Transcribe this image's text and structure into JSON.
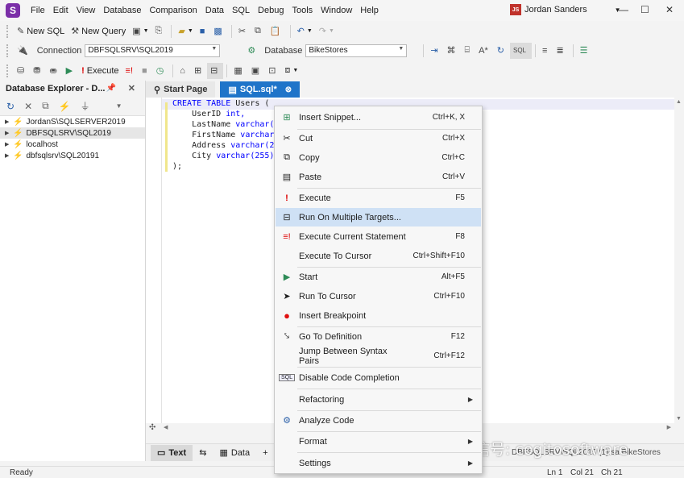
{
  "menubar": {
    "logo": "S",
    "items": [
      "File",
      "Edit",
      "View",
      "Database",
      "Comparison",
      "Data",
      "SQL",
      "Debug",
      "Tools",
      "Window",
      "Help"
    ],
    "user_initials": "JS",
    "user_name": "Jordan Sanders"
  },
  "toolbar1": {
    "new_sql": "New SQL",
    "new_query": "New Query",
    "connection_label": "Connection",
    "connection_value": "DBFSQLSRV\\SQL2019",
    "database_label": "Database",
    "database_value": "BikeStores"
  },
  "toolbar2": {
    "execute": "Execute"
  },
  "explorer": {
    "title": "Database Explorer - D...",
    "items": [
      {
        "label": "JordanS\\SQLSERVER2019"
      },
      {
        "label": "DBFSQLSRV\\SQL2019"
      },
      {
        "label": "localhost"
      },
      {
        "label": "dbfsqlsrv\\SQL20191"
      }
    ]
  },
  "tabs": {
    "start_page": "Start Page",
    "sql": "SQL.sql*"
  },
  "editor": {
    "lines": [
      {
        "kw": "CREATE TABLE",
        "text": " Users ("
      },
      {
        "text": "    UserID ",
        "kw2": "int,"
      },
      {
        "text": "    LastName ",
        "kw2": "varchar("
      },
      {
        "text": "    FirstName ",
        "kw2": "varchar"
      },
      {
        "text": "    Address ",
        "kw2": "varchar(2"
      },
      {
        "text": "    City ",
        "kw2": "varchar(255)"
      },
      {
        "text": ");"
      }
    ]
  },
  "bottom_tabs": {
    "text": "Text",
    "data": "Data"
  },
  "connection_status": "DBFSQLSRV\\SQL2019 (1)   sa   BikeStores",
  "statusbar": {
    "ready": "Ready",
    "ln": "Ln 1",
    "col": "Col 21",
    "ch": "Ch 21"
  },
  "context_menu": [
    {
      "label": "Insert Snippet...",
      "shortcut": "Ctrl+K, X",
      "icon": "snippet-icon"
    },
    {
      "label": "Cut",
      "shortcut": "Ctrl+X",
      "icon": "cut-icon"
    },
    {
      "label": "Copy",
      "shortcut": "Ctrl+C",
      "icon": "copy-icon"
    },
    {
      "label": "Paste",
      "shortcut": "Ctrl+V",
      "icon": "paste-icon"
    },
    {
      "label": "Execute",
      "shortcut": "F5",
      "icon": "execute-icon"
    },
    {
      "label": "Run On Multiple Targets...",
      "shortcut": "",
      "icon": "multiple-targets-icon"
    },
    {
      "label": "Execute Current Statement",
      "shortcut": "F8",
      "icon": "execute-statement-icon"
    },
    {
      "label": "Execute To Cursor",
      "shortcut": "Ctrl+Shift+F10",
      "icon": ""
    },
    {
      "label": "Start",
      "shortcut": "Alt+F5",
      "icon": "start-icon"
    },
    {
      "label": "Run To Cursor",
      "shortcut": "Ctrl+F10",
      "icon": "cursor-icon"
    },
    {
      "label": "Insert Breakpoint",
      "shortcut": "",
      "icon": "breakpoint-icon"
    },
    {
      "label": "Go To Definition",
      "shortcut": "F12",
      "icon": "definition-icon"
    },
    {
      "label": "Jump Between Syntax Pairs",
      "shortcut": "Ctrl+F12",
      "icon": ""
    },
    {
      "label": "Disable Code Completion",
      "shortcut": "",
      "icon": "sql-icon"
    },
    {
      "label": "Refactoring",
      "shortcut": "",
      "icon": ""
    },
    {
      "label": "Analyze Code",
      "shortcut": "",
      "icon": "analyze-icon"
    },
    {
      "label": "Format",
      "shortcut": "",
      "icon": ""
    },
    {
      "label": "Settings",
      "shortcut": "",
      "icon": ""
    }
  ],
  "watermark": "微信号: cogitosoftware",
  "colors": {
    "active_tab": "#1f74c9",
    "menu_highlight": "#cfe1f5",
    "keyword": "#0000ff"
  }
}
